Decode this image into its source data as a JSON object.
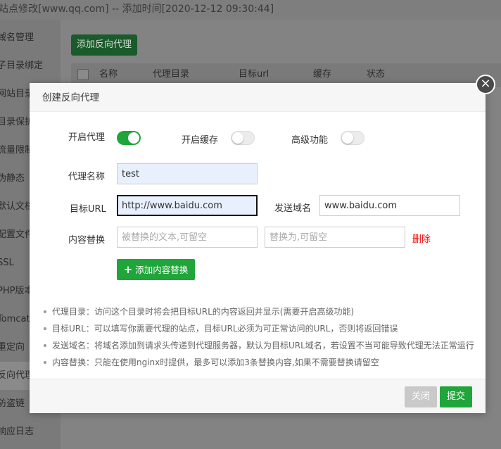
{
  "window_title": "站点修改[www.qq.com] -- 添加时间[2020-12-12 09:30:44]",
  "sidebar": {
    "items": [
      {
        "label": "域名管理"
      },
      {
        "label": "子目录绑定"
      },
      {
        "label": "网站目录"
      },
      {
        "label": "目录保护"
      },
      {
        "label": "流量限制"
      },
      {
        "label": "伪静态"
      },
      {
        "label": "默认文档"
      },
      {
        "label": "配置文件"
      },
      {
        "label": "SSL"
      },
      {
        "label": "PHP版本"
      },
      {
        "label": "Tomcat"
      },
      {
        "label": "重定向"
      },
      {
        "label": "反向代理"
      },
      {
        "label": "防盗链"
      },
      {
        "label": "响应日志"
      }
    ]
  },
  "main": {
    "add_button": "添加反向代理",
    "table_headers": [
      "名称",
      "代理目录",
      "目标url",
      "缓存",
      "状态"
    ]
  },
  "modal": {
    "title": "创建反向代理",
    "close_icon": "close-icon",
    "toggles": [
      {
        "label": "开启代理",
        "on": true
      },
      {
        "label": "开启缓存",
        "on": false
      },
      {
        "label": "高级功能",
        "on": false
      }
    ],
    "proxy_name": {
      "label": "代理名称",
      "value": "test"
    },
    "target_url": {
      "label": "目标URL",
      "value": "http://www.baidu.com"
    },
    "send_domain": {
      "label": "发送域名",
      "value": "www.baidu.com"
    },
    "content_replace": {
      "label": "内容替换",
      "from_placeholder": "被替换的文本,可留空",
      "to_placeholder": "替换为,可留空",
      "delete_label": "删除"
    },
    "add_replace_button": "添加内容替换",
    "help": [
      "代理目录：访问这个目录时将会把目标URL的内容返回并显示(需要开启高级功能)",
      "目标URL：可以填写你需要代理的站点，目标URL必须为可正常访问的URL，否则将返回错误",
      "发送域名：将域名添加到请求头传递到代理服务器，默认为目标URL域名，若设置不当可能导致代理无法正常运行",
      "内容替换：只能在使用nginx时提供，最多可以添加3条替换内容,如果不需要替换请留空"
    ],
    "footer": {
      "close_label": "关闭",
      "submit_label": "提交"
    }
  },
  "colors": {
    "accent": "#20a53a",
    "danger": "#ef0808",
    "overlay": "#7c7c7c"
  }
}
